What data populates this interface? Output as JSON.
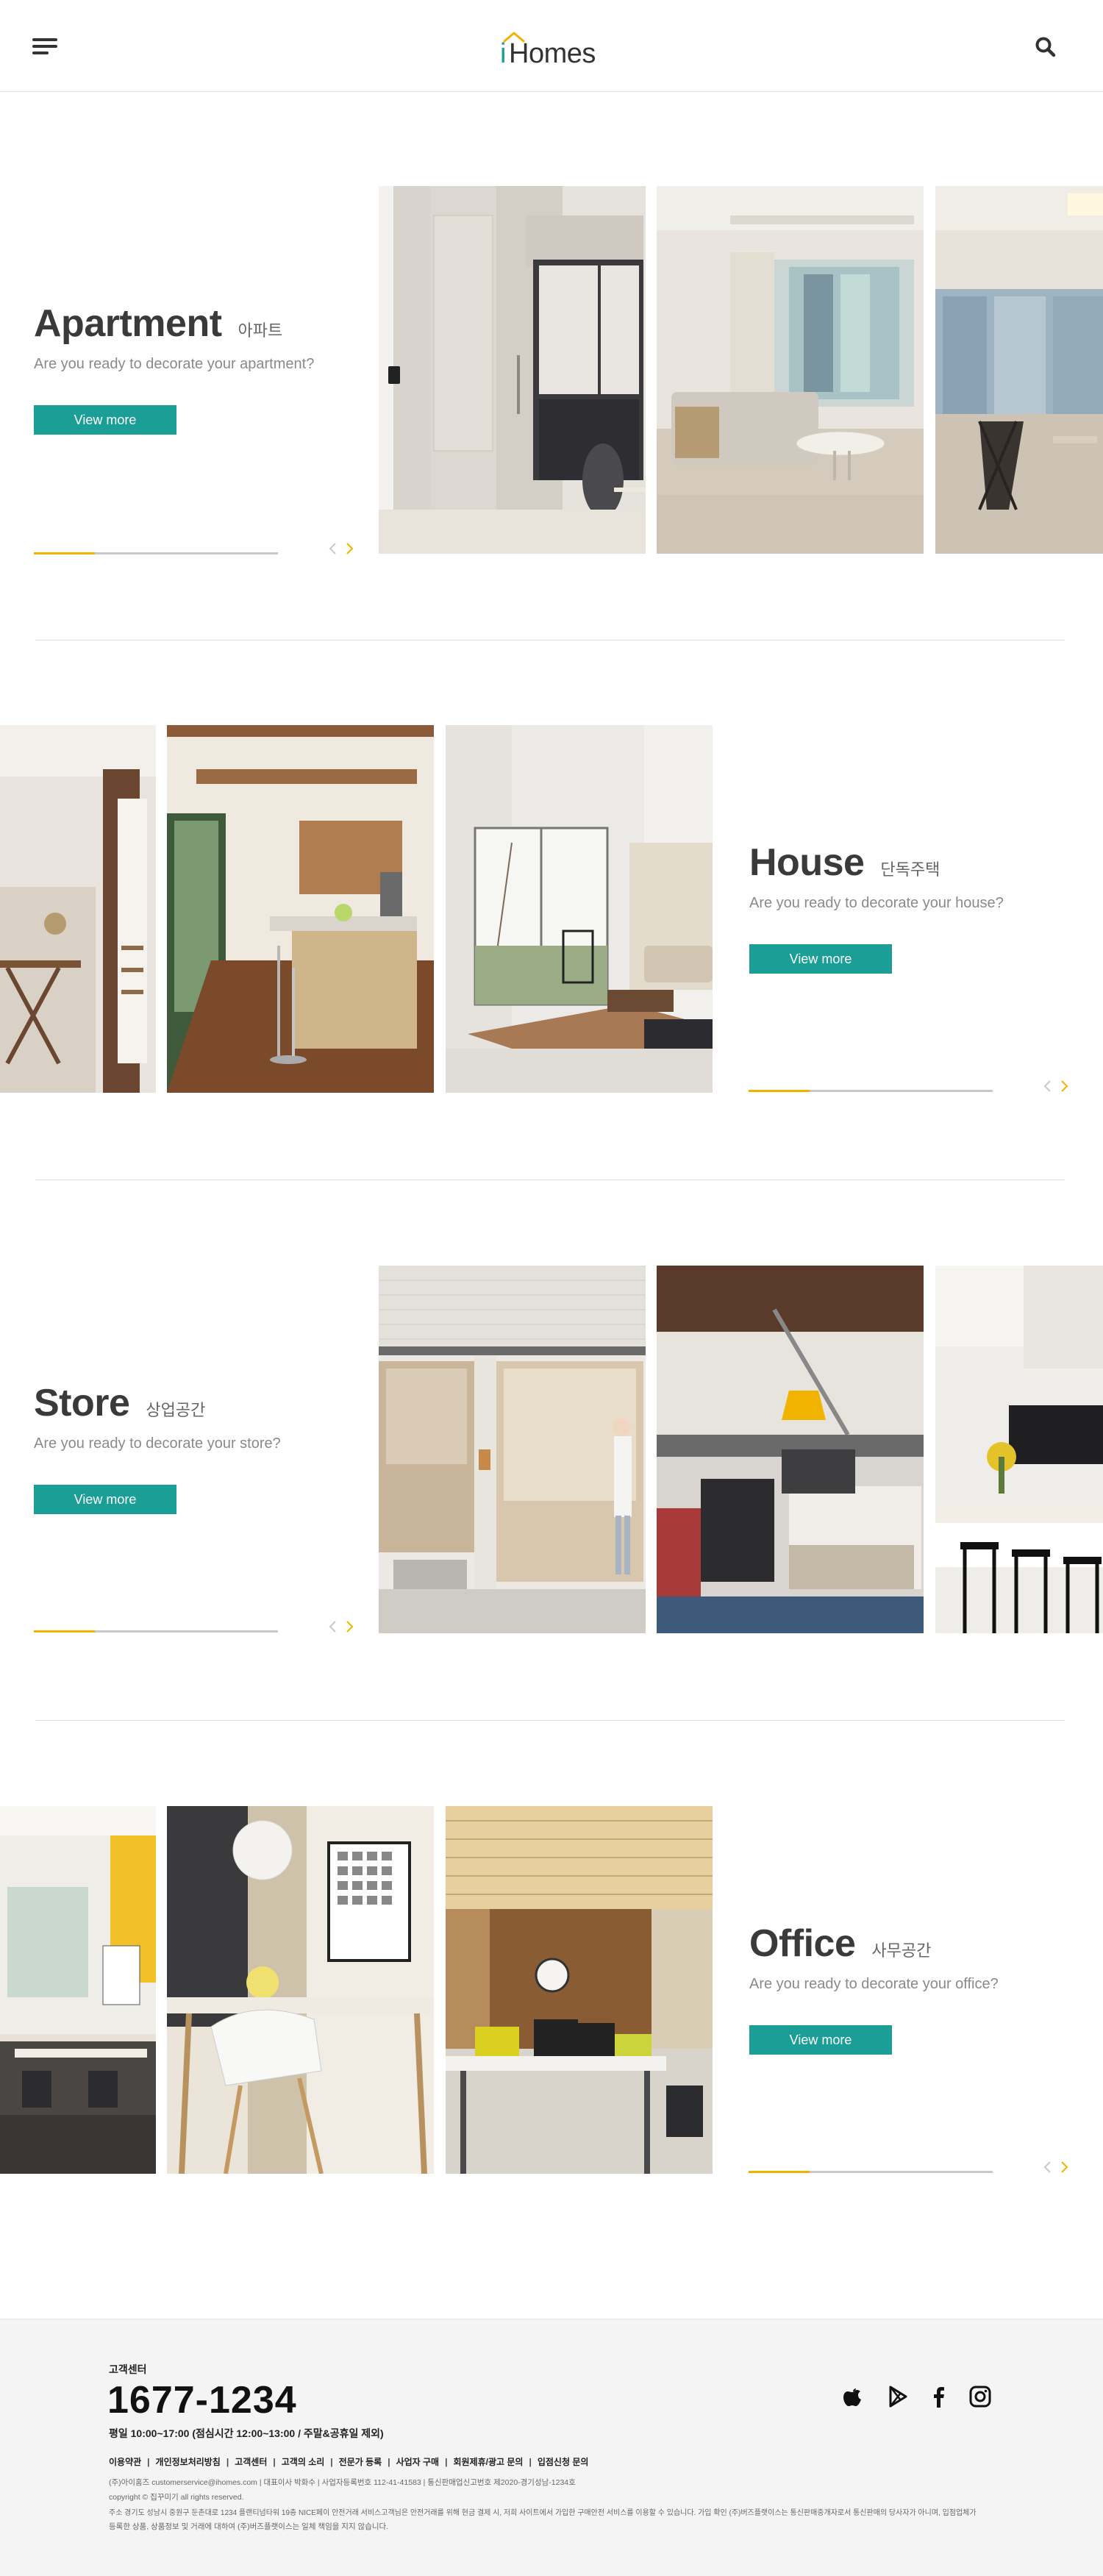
{
  "header": {
    "logo_i": "i",
    "logo_text": "Homes"
  },
  "sections": [
    {
      "title": "Apartment",
      "subtitle_ko": "아파트",
      "description": "Are you ready to decorate your apartment?",
      "button": "View more",
      "progress": 0.25
    },
    {
      "title": "House",
      "subtitle_ko": "단독주택",
      "description": "Are you ready to decorate your house?",
      "button": "View more",
      "progress": 0.25
    },
    {
      "title": "Store",
      "subtitle_ko": "상업공간",
      "description": "Are you ready to decorate your store?",
      "button": "View more",
      "progress": 0.25
    },
    {
      "title": "Office",
      "subtitle_ko": "사무공간",
      "description": "Are you ready to decorate your office?",
      "button": "View more",
      "progress": 0.25
    }
  ],
  "footer": {
    "label": "고객센터",
    "phone": "1677-1234",
    "hours": "평일 10:00~17:00 (점심시간 12:00~13:00 / 주말&공휴일 제외)",
    "links": [
      "이용약관",
      "개인정보처리방침",
      "고객센터",
      "고객의 소리",
      "전문가 등록",
      "사업자 구매",
      "회원제휴/광고 문의",
      "입점신청 문의"
    ],
    "company_line": "(주)아이홈즈 customerservice@ihomes.com | 대표이사 박화수 | 사업자등록번호 112-41-41583 | 통신판매업신고번호 제2020-경기성남-1234호",
    "copyright": "copyright © 집꾸미기 all rights reserved.",
    "notice_line1": "주소 경기도 성남시 중원구 둔촌대로 1234 플랜티넘타워 19층 NICE페이 안전거래 서비스고객님은 안전거래를 위해 현금 결제 시, 저희 사이트에서 가입한 구매안전 서비스를 이용할 수 있습니다. 가입 확인 (주)버즈플랫이스는 통신판매중개자로서 통신판매의 당사자가 아니며, 입점업체가",
    "notice_line2": "등록한 상품, 상품정보 및 거래에 대하여 (주)버즈플랫이스는 일체 책임을 지지 않습니다."
  },
  "colors": {
    "accent_teal": "#1a9e96",
    "accent_yellow": "#f0b400",
    "text_dark": "#3a3a3a"
  },
  "icons": [
    "menu-icon",
    "search-icon",
    "chevron-left-icon",
    "chevron-right-icon",
    "apple-icon",
    "google-play-icon",
    "facebook-icon",
    "instagram-icon"
  ]
}
